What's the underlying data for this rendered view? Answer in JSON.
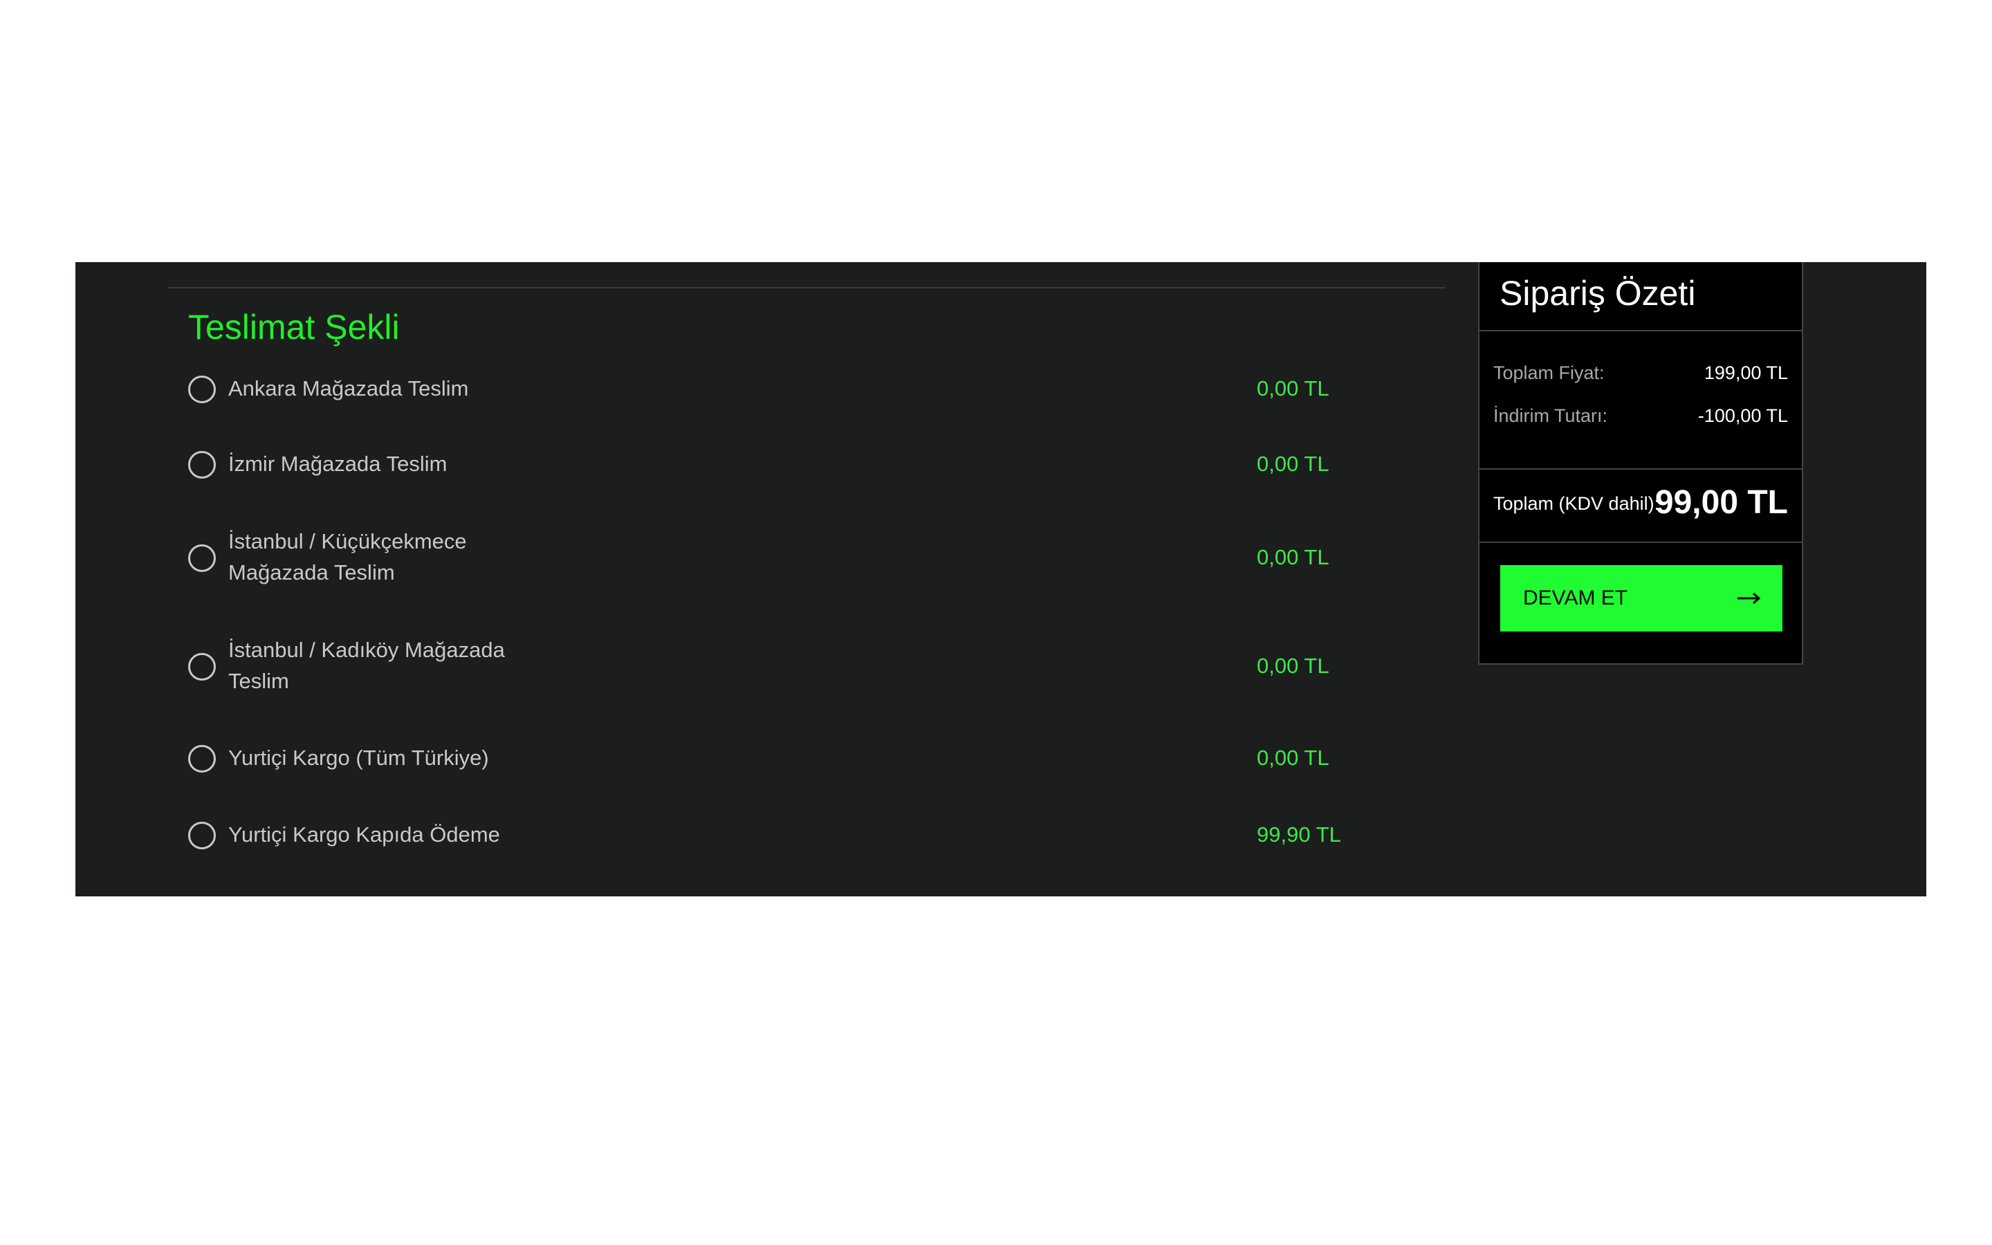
{
  "delivery": {
    "title": "Teslimat Şekli",
    "options": [
      {
        "label": "Ankara Mağazada Teslim",
        "price": "0,00 TL"
      },
      {
        "label": "İzmir Mağazada Teslim",
        "price": "0,00 TL"
      },
      {
        "label": "İstanbul / Küçükçekmece Mağazada Teslim",
        "price": "0,00 TL"
      },
      {
        "label": "İstanbul / Kadıköy Mağazada Teslim",
        "price": "0,00 TL"
      },
      {
        "label": "Yurtiçi Kargo (Tüm Türkiye)",
        "price": "0,00 TL"
      },
      {
        "label": "Yurtiçi Kargo Kapıda Ödeme",
        "price": "99,90 TL"
      }
    ]
  },
  "summary": {
    "title": "Sipariş Özeti",
    "subtotal_label": "Toplam Fiyat:",
    "subtotal_value": "199,00 TL",
    "discount_label": "İndirim Tutarı:",
    "discount_value": "-100,00 TL",
    "total_label": "Toplam (KDV dahil):",
    "total_value": "99,00 TL",
    "continue_label": "DEVAM ET"
  },
  "colors": {
    "panel_bg": "#1c1d1d",
    "accent_green": "#22ee2b",
    "button_green": "#1ffc31",
    "summary_bg": "#000000"
  },
  "icons": {
    "radio": "radio-unchecked-icon",
    "continue": "arrow-right-icon"
  }
}
